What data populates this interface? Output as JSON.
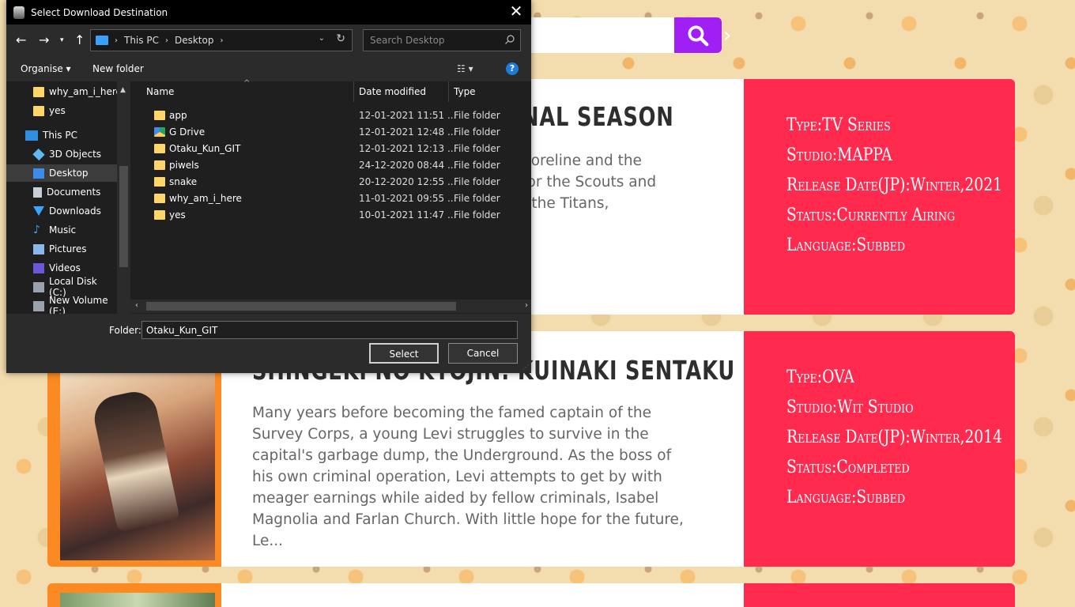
{
  "website": {
    "cards": [
      {
        "title": "NAL SEASON",
        "description": "horeline and the\nfor the Scouts and\nf the Titans,",
        "info": [
          "Type:TV Series",
          "Studio:MAPPA",
          "Release Date(JP):Winter,2021",
          "Status:Currently Airing",
          "Language:Subbed"
        ]
      },
      {
        "title": "SHINGEKI NO KYOJIN: KUINAKI SENTAKU",
        "description": "Many years before becoming the famed captain of the Survey Corps, a young Levi struggles to survive in the capital's garbage dump, the Underground. As the boss of his own criminal operation, Levi attempts to get by with meager earnings while aided by fellow criminals, Isabel Magnolia and Farlan Church. With little hope for the future, Le...",
        "info": [
          "Type:OVA",
          "Studio:Wit Studio",
          "Release Date(JP):Winter,2014",
          "Status:Completed",
          "Language:Subbed"
        ]
      }
    ]
  },
  "dialog": {
    "title": "Select Download Destination",
    "address": {
      "segments": [
        "This PC",
        "Desktop"
      ]
    },
    "search_placeholder": "Search Desktop",
    "toolbar": {
      "organise": "Organise ▾",
      "new_folder": "New folder"
    },
    "nav": [
      {
        "label": "why_am_i_here",
        "icon": "folder-icon"
      },
      {
        "label": "yes",
        "icon": "folder-icon"
      },
      {
        "label": "This PC",
        "icon": "computer-icon"
      },
      {
        "label": "3D Objects",
        "icon": "cube-icon"
      },
      {
        "label": "Desktop",
        "icon": "desktop-icon",
        "selected": true
      },
      {
        "label": "Documents",
        "icon": "document-icon"
      },
      {
        "label": "Downloads",
        "icon": "download-icon"
      },
      {
        "label": "Music",
        "icon": "music-icon"
      },
      {
        "label": "Pictures",
        "icon": "pictures-icon"
      },
      {
        "label": "Videos",
        "icon": "videos-icon"
      },
      {
        "label": "Local Disk (C:)",
        "icon": "disk-icon"
      },
      {
        "label": "New Volume (E:)",
        "icon": "disk-icon"
      }
    ],
    "columns": {
      "name": "Name",
      "date": "Date modified",
      "type": "Type"
    },
    "files": [
      {
        "name": "app",
        "date": "12-01-2021 11:51 ...",
        "type": "File folder",
        "icon": "folder-icon"
      },
      {
        "name": "G Drive",
        "date": "12-01-2021 12:48 ...",
        "type": "File folder",
        "icon": "google-drive-icon"
      },
      {
        "name": "Otaku_Kun_GIT",
        "date": "12-01-2021 12:13 ...",
        "type": "File folder",
        "icon": "folder-icon"
      },
      {
        "name": "piwels",
        "date": "24-12-2020 08:44 ...",
        "type": "File folder",
        "icon": "folder-icon"
      },
      {
        "name": "snake",
        "date": "20-12-2020 12:55 ...",
        "type": "File folder",
        "icon": "folder-icon"
      },
      {
        "name": "why_am_i_here",
        "date": "11-01-2021 09:55 ...",
        "type": "File folder",
        "icon": "folder-icon"
      },
      {
        "name": "yes",
        "date": "10-01-2021 11:47 ...",
        "type": "File folder",
        "icon": "folder-icon"
      }
    ],
    "folder_label": "Folder:",
    "folder_value": "Otaku_Kun_GIT",
    "select_label": "Select",
    "cancel_label": "Cancel"
  },
  "colors": {
    "accent": "#9f1ff5",
    "info_panel": "#ff2a4e",
    "poster_frame": "#fb8a22",
    "dialog_bg": "#2b2b2b"
  }
}
